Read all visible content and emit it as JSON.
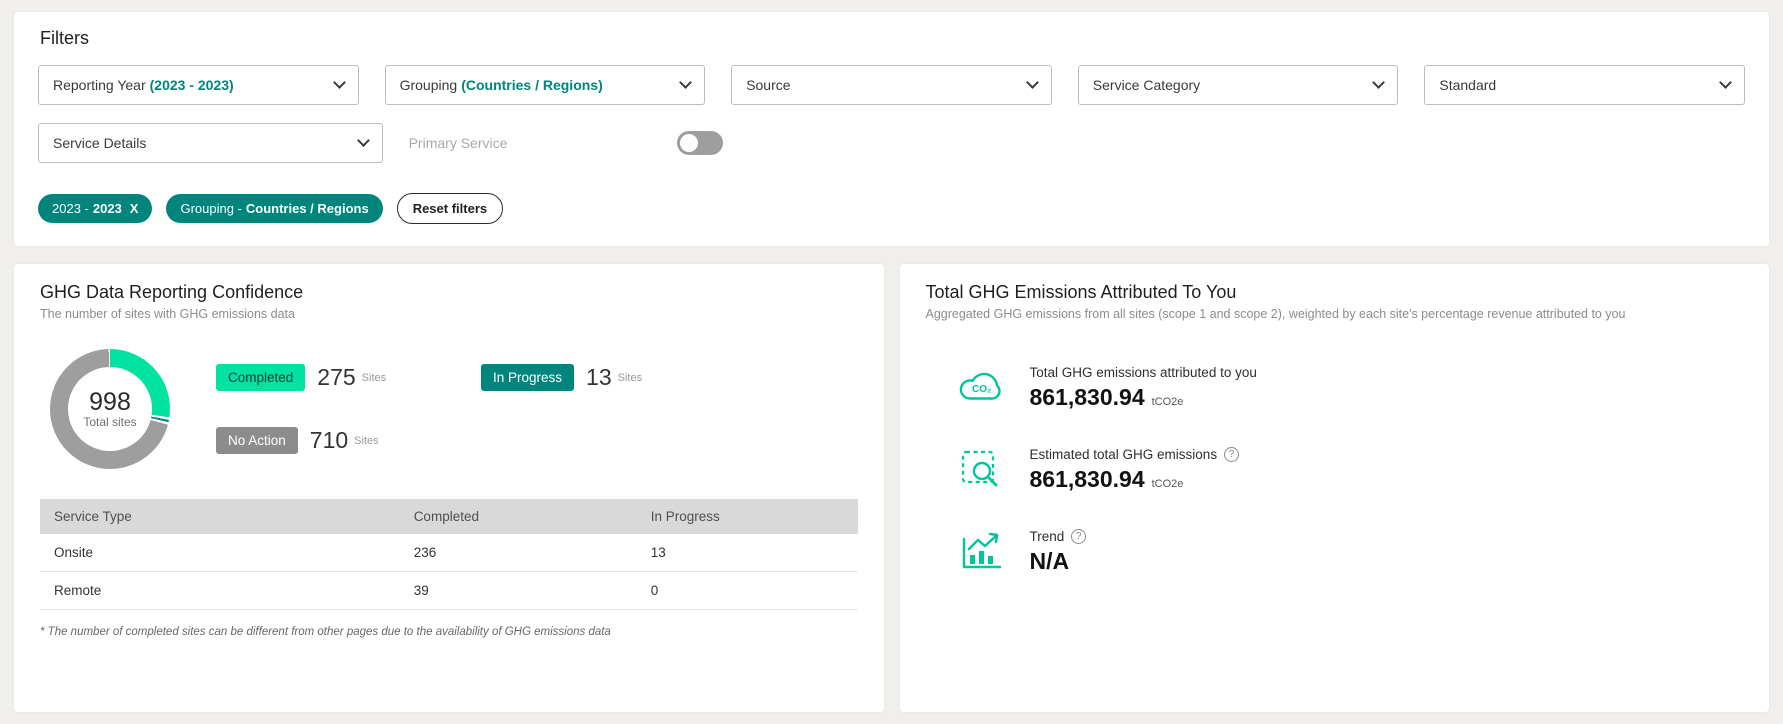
{
  "filters": {
    "title": "Filters",
    "dropdowns": [
      {
        "label": "Reporting Year",
        "value": "(2023 - 2023)"
      },
      {
        "label": "Grouping",
        "value": "(Countries / Regions)"
      },
      {
        "label": "Source",
        "value": ""
      },
      {
        "label": "Service Category",
        "value": ""
      },
      {
        "label": "Standard",
        "value": ""
      },
      {
        "label": "Service Details",
        "value": ""
      }
    ],
    "primary_service_label": "Primary Service",
    "chips": [
      {
        "prefix": "2023 -",
        "bold": "2023",
        "close": "X"
      },
      {
        "prefix": "Grouping -",
        "bold": "Countries / Regions"
      }
    ],
    "reset_label": "Reset filters"
  },
  "confidence": {
    "title": "GHG Data Reporting Confidence",
    "subtitle": "The number of sites with GHG emissions data",
    "donut": {
      "total": "998",
      "total_label": "Total sites"
    },
    "legend": [
      {
        "badge": "Completed",
        "value": "275",
        "unit": "Sites"
      },
      {
        "badge": "In Progress",
        "value": "13",
        "unit": "Sites"
      },
      {
        "badge": "No Action",
        "value": "710",
        "unit": "Sites"
      }
    ],
    "table": {
      "headers": [
        "Service Type",
        "Completed",
        "In Progress"
      ],
      "rows": [
        [
          "Onsite",
          "236",
          "13"
        ],
        [
          "Remote",
          "39",
          "0"
        ]
      ]
    },
    "footnote": "* The number of completed sites can be different from other pages due to the availability of GHG emissions data"
  },
  "emissions": {
    "title": "Total GHG Emissions Attributed To You",
    "subtitle": "Aggregated GHG emissions from all sites (scope 1 and scope 2), weighted by each site's percentage revenue attributed to you",
    "metrics": [
      {
        "label": "Total GHG emissions attributed to you",
        "value": "861,830.94",
        "unit": "tCO2e"
      },
      {
        "label": "Estimated total GHG emissions",
        "info": "?",
        "value": "861,830.94",
        "unit": "tCO2e"
      },
      {
        "label": "Trend",
        "info": "?",
        "value": "N/A",
        "unit": ""
      }
    ]
  },
  "colors": {
    "accent_teal": "#00857d",
    "mint_green": "#00e3a0",
    "badge_gray": "#8c8c8c",
    "icon_green": "#00c49a"
  },
  "chart_data": {
    "type": "pie",
    "title": "GHG Data Reporting Confidence",
    "categories": [
      "Completed",
      "In Progress",
      "No Action"
    ],
    "values": [
      275,
      13,
      710
    ],
    "total": 998,
    "colors": [
      "#00e3a0",
      "#00857d",
      "#9e9e9e"
    ],
    "center_label": "998 Total sites",
    "legend_position": "right"
  }
}
